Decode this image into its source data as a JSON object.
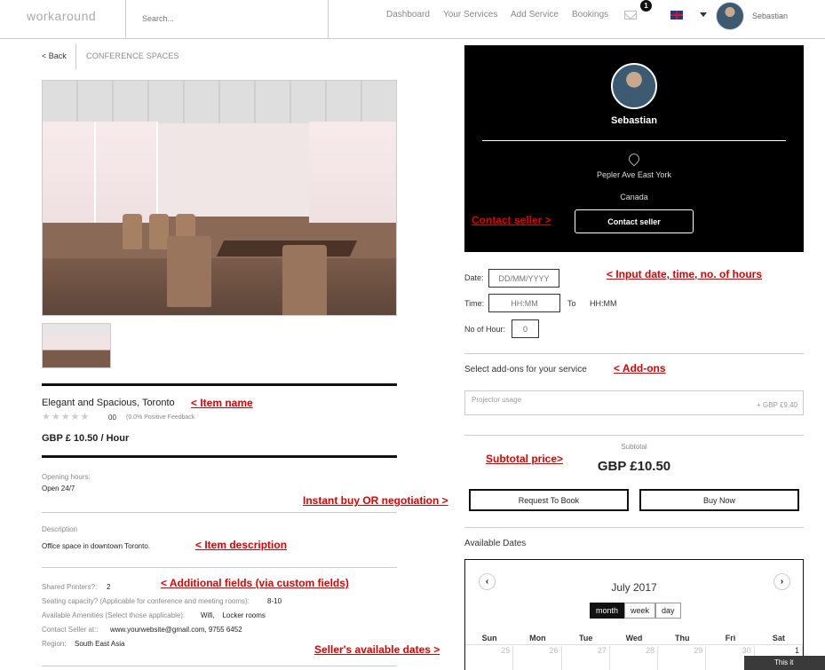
{
  "header": {
    "logo": "workaround",
    "search_placeholder": "Search...",
    "nav": [
      "Dashboard",
      "Your Services",
      "Add Service",
      "Bookings"
    ],
    "notification_count": "1",
    "user_name": "Sebastian"
  },
  "breadcrumb": {
    "back": "< Back",
    "category": "CONFERENCE SPACES"
  },
  "listing": {
    "name": "Elegant and Spacious, Toronto",
    "stars": "★★★★★",
    "rating_count": "00",
    "feedback": "(0.0% Positive Feedback",
    "price": "GBP £ 10.50 / Hour",
    "opening_label": "Opening hours:",
    "opening_value": "Open 24/7",
    "description_label": "Description",
    "description_value": "Office space in downtown Toronto.",
    "fields": [
      {
        "label": "Shared Printers?:",
        "value": "2"
      },
      {
        "label": "Seating capacity? (Applicable for conference and meeting rooms):",
        "value": "8-10"
      },
      {
        "label": "Available Amenities (Select those applicable):",
        "value": "Wifi,    Locker rooms"
      },
      {
        "label": "Contact Seller at::",
        "value": "www.yourwebsite@gmail.com, 9755 6452"
      },
      {
        "label": "Region:",
        "value": "South East Asia"
      }
    ]
  },
  "seller": {
    "name": "Sebastian",
    "address": "Pepler Ave East York",
    "country": "Canada",
    "contact_button": "Contact seller"
  },
  "booking": {
    "date_label": "Date:",
    "date_placeholder": "DD/MM/YYYY",
    "time_label": "Time:",
    "time_placeholder": "HH:MM",
    "to_label": "To",
    "to_value": "HH:MM",
    "hours_label": "No of Hour:",
    "hours_value": "0",
    "addons_title": "Select add-ons for your service",
    "addon_name": "Projector usage",
    "addon_price": "+ GBP £9.40",
    "subtotal_label": "Subtotal",
    "subtotal_value": "GBP £10.50",
    "request_button": "Request To Book",
    "buy_button": "Buy Now",
    "available_title": "Available Dates"
  },
  "calendar": {
    "month": "July 2017",
    "prev": "‹",
    "next": "›",
    "views": [
      "month",
      "week",
      "day"
    ],
    "days": [
      "Sun",
      "Mon",
      "Tue",
      "Wed",
      "Thu",
      "Fri",
      "Sat"
    ],
    "first_row": [
      "25",
      "26",
      "27",
      "28",
      "29",
      "30",
      "1"
    ]
  },
  "annotations": {
    "contact": "Contact seller >",
    "input": "< Input date, time, no. of hours",
    "addons": "< Add-ons",
    "item_name": "< Item name",
    "subtotal": "Subtotal price>",
    "instant": "Instant buy OR negotiation >",
    "description": "< Item description",
    "fields": "< Additional fields (via custom fields)",
    "dates": "Seller's available dates >"
  },
  "tooltip": "This it",
  "colors": {
    "annotation": "#e00000",
    "profile_bg": "#000000"
  }
}
